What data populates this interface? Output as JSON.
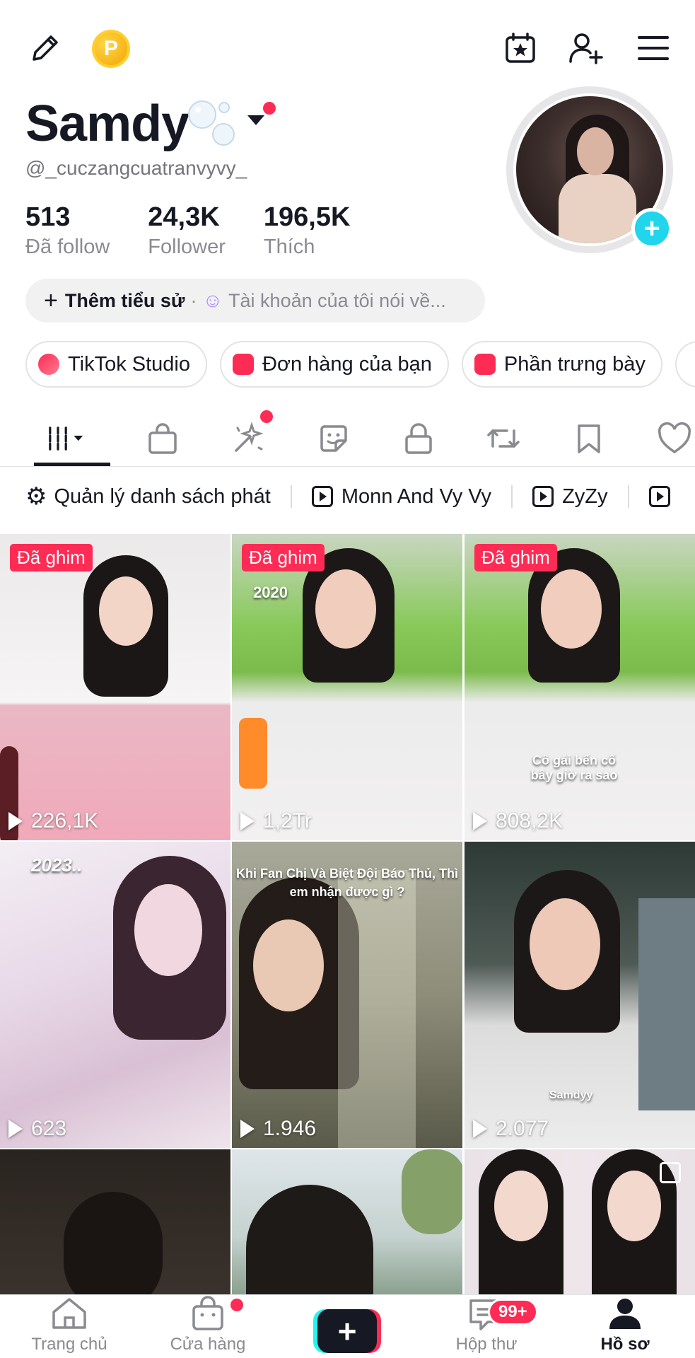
{
  "header": {
    "display_name": "Samdy",
    "handle": "@_cuczangcuatranvyvy_",
    "coin_letter": "P"
  },
  "stats": [
    {
      "value": "513",
      "label": "Đã follow"
    },
    {
      "value": "24,3K",
      "label": "Follower"
    },
    {
      "value": "196,5K",
      "label": "Thích"
    }
  ],
  "bio": {
    "add_label": "Thêm tiểu sử",
    "separator": "·",
    "placeholder": "Tài khoản của tôi nói về..."
  },
  "chips": [
    {
      "label": "TikTok Studio",
      "icon": "studio-icon"
    },
    {
      "label": "Đơn hàng của bạn",
      "icon": "orders-bag-icon"
    },
    {
      "label": "Phần trưng bày",
      "icon": "showcase-bag-icon"
    }
  ],
  "tabs": [
    "videos-grid-icon",
    "shop-bag-icon",
    "sparkle-icon",
    "sticker-icon",
    "lock-icon",
    "repost-icon",
    "bookmark-icon",
    "heart-icon"
  ],
  "playlists": {
    "manage": "Quản lý danh sách phát",
    "items": [
      "Monn And Vy Vy",
      "ZyZy"
    ]
  },
  "grid": [
    {
      "pinned": "Đã ghim",
      "views": "226,1K"
    },
    {
      "pinned": "Đã ghim",
      "views": "1,2Tr",
      "overlay": "2020"
    },
    {
      "pinned": "Đã ghim",
      "views": "808,2K",
      "overlay": "Cô gái bến cố bây giờ ra sao"
    },
    {
      "views": "623",
      "overlay": "2023.."
    },
    {
      "views": "1.946",
      "overlay": "Khi Fan Chị Và Biệt Đội Báo Thủ, Thì em nhận được gì ?"
    },
    {
      "views": "2.077",
      "overlay": "Samdyy"
    },
    {},
    {},
    {}
  ],
  "bottom_nav": {
    "home": "Trang chủ",
    "shop": "Cửa hàng",
    "inbox": "Hộp thư",
    "profile": "Hồ sơ",
    "inbox_badge": "99+"
  },
  "colors": {
    "accent": "#fe2c55",
    "cyan": "#25f4ee",
    "text": "#161823",
    "muted": "#8a8b91"
  }
}
